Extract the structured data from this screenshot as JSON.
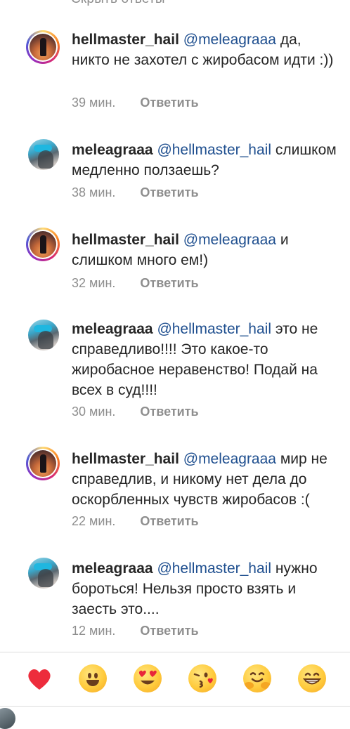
{
  "header": {
    "hide_replies": "Скрыть ответы"
  },
  "comments": [
    {
      "user": "hellmaster_hail",
      "mention": "@meleagraaa",
      "text": " да, никто не захотел с жиробасом идти :))",
      "time": "39 мин.",
      "reply": "Ответить",
      "avatar": "story-ring-avatar"
    },
    {
      "user": "meleagraaa",
      "mention": "@hellmaster_hail",
      "text": " слишком медленно ползаешь?",
      "time": "38 мин.",
      "reply": "Ответить",
      "avatar": "plain-avatar"
    },
    {
      "user": "hellmaster_hail",
      "mention": "@meleagraaa",
      "text": " и слишком много ем!)",
      "time": "32 мин.",
      "reply": "Ответить",
      "avatar": "story-ring-avatar"
    },
    {
      "user": "meleagraaa",
      "mention": "@hellmaster_hail",
      "text": " это не справедливо!!!! Это какое-то жиробасное неравенство! Подай на всех в суд!!!!",
      "time": "30 мин.",
      "reply": "Ответить",
      "avatar": "plain-avatar"
    },
    {
      "user": "hellmaster_hail",
      "mention": "@meleagraaa",
      "text": " мир не справедлив, и никому нет дела до оскорбленных чувств жиробасов :(",
      "time": "22 мин.",
      "reply": "Ответить",
      "avatar": "story-ring-avatar"
    },
    {
      "user": "meleagraaa",
      "mention": "@hellmaster_hail",
      "text": " нужно бороться! Нельзя просто взять и заесть это....",
      "time": "12 мин.",
      "reply": "Ответить",
      "avatar": "plain-avatar"
    }
  ],
  "emoji_bar": [
    "heart-icon",
    "grinning-face-icon",
    "heart-eyes-face-icon",
    "kissing-face-icon",
    "hugging-face-icon",
    "beaming-face-icon"
  ],
  "colors": {
    "text": "#262626",
    "secondary": "#8e8e8e",
    "mention": "#1f4f8f",
    "divider": "#dbdbdb",
    "heart": "#ed2c3c",
    "emoji_yellow": "#ffcb3d"
  }
}
